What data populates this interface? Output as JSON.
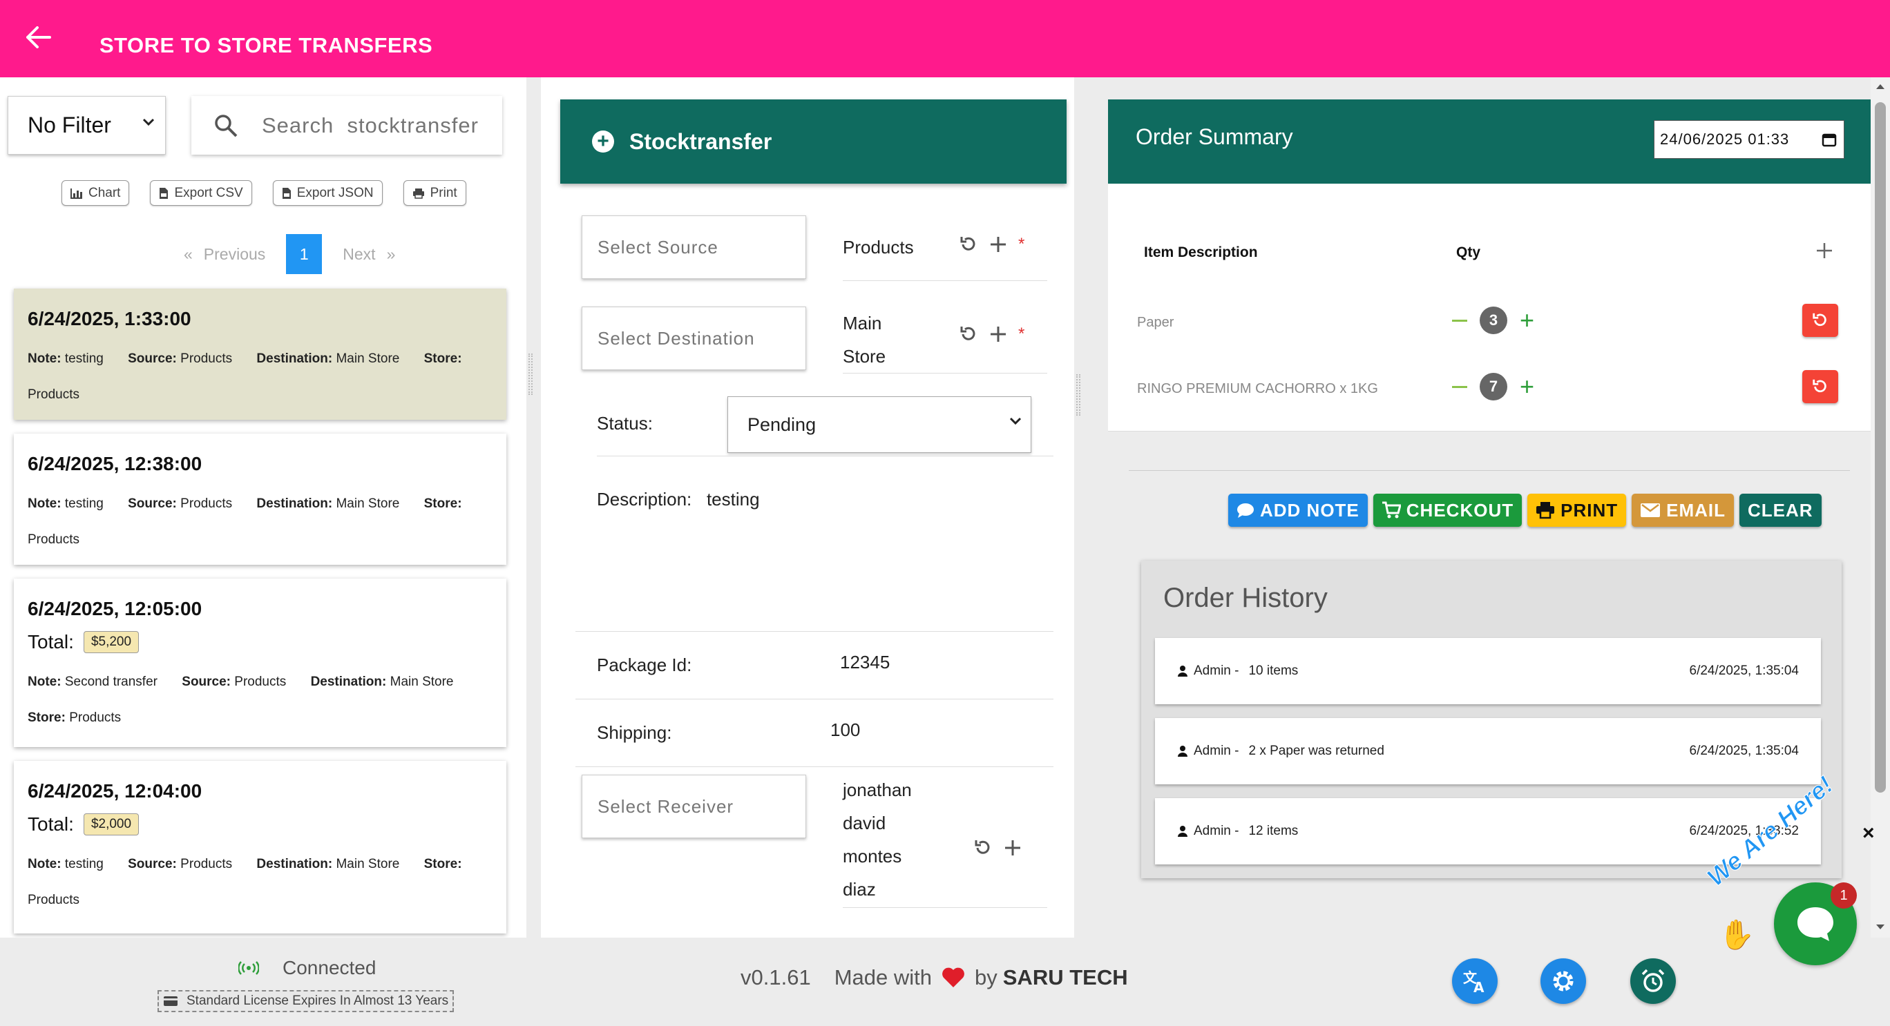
{
  "header": {
    "title": "STORE TO STORE TRANSFERS"
  },
  "left": {
    "filter_value": "No Filter",
    "search_placeholder": "Search  stocktransfer",
    "toolbar": {
      "chart": "Chart",
      "export_csv": "Export CSV",
      "export_json": "Export JSON",
      "print": "Print"
    },
    "pager": {
      "prev": "Previous",
      "page": "1",
      "next": "Next",
      "first": "«",
      "last": "»"
    },
    "labels": {
      "note": "Note:",
      "source": "Source:",
      "destination": "Destination:",
      "store": "Store:",
      "total": "Total:"
    },
    "transfers": [
      {
        "timestamp": "6/24/2025, 1:33:00",
        "note": "testing",
        "source": "Products",
        "destination": "Main Store",
        "store": "Products",
        "total": ""
      },
      {
        "timestamp": "6/24/2025, 12:38:00",
        "note": "testing",
        "source": "Products",
        "destination": "Main Store",
        "store": "Products",
        "total": ""
      },
      {
        "timestamp": "6/24/2025, 12:05:00",
        "note": "Second transfer",
        "source": "Products",
        "destination": "Main Store",
        "store": "Products",
        "total": "$5,200"
      },
      {
        "timestamp": "6/24/2025, 12:04:00",
        "note": "testing",
        "source": "Products",
        "destination": "Main Store",
        "store": "Products",
        "total": "$2,000"
      }
    ]
  },
  "stocktransfer": {
    "title": "Stocktransfer",
    "source_placeholder": "Select  Source",
    "source_value": "Products",
    "destination_placeholder": "Select  Destination",
    "destination_value_line1": "Main",
    "destination_value_line2": "Store",
    "status_label": "Status:",
    "status_value": "Pending",
    "description_label": "Description:",
    "description_value": "testing",
    "package_label": "Package Id:",
    "package_value": "12345",
    "shipping_label": "Shipping:",
    "shipping_value": "100",
    "receiver_placeholder": "Select  Receiver",
    "receiver_lines": [
      "jonathan",
      "david",
      "montes",
      "diaz"
    ],
    "required_mark": "*"
  },
  "order_summary": {
    "title": "Order Summary",
    "date_value": "24/06/2025 01:33",
    "col_item": "Item Description",
    "col_qty": "Qty",
    "items": [
      {
        "name": "Paper",
        "qty": "3"
      },
      {
        "name": "RINGO PREMIUM CACHORRO x 1KG",
        "qty": "7"
      }
    ],
    "actions": {
      "add_note": "ADD NOTE",
      "checkout": "CHECKOUT",
      "print": "PRINT",
      "email": "EMAIL",
      "clear": "CLEAR"
    }
  },
  "history": {
    "title": "Order History",
    "entries": [
      {
        "user": "Admin -",
        "message": "10 items",
        "time": "6/24/2025, 1:35:04"
      },
      {
        "user": "Admin -",
        "message": "2 x Paper was returned",
        "time": "6/24/2025, 1:35:04"
      },
      {
        "user": "Admin -",
        "message": "12 items",
        "time": "6/24/2025, 1:33:52"
      }
    ]
  },
  "footer": {
    "status": "Connected",
    "license": "Standard License Expires In Almost 13 Years",
    "version": "v0.1.61",
    "made_with": "Made with",
    "by": "by",
    "brand": "SARU TECH"
  },
  "chat": {
    "badge": "1",
    "tagline": "We Are Here!",
    "close": "×"
  },
  "colors": {
    "header": "#ff1a8c",
    "teal": "#0f6b5f",
    "primary": "#2196f3",
    "danger": "#f44336",
    "success": "#1b9a3c",
    "warning": "#ffc107"
  }
}
